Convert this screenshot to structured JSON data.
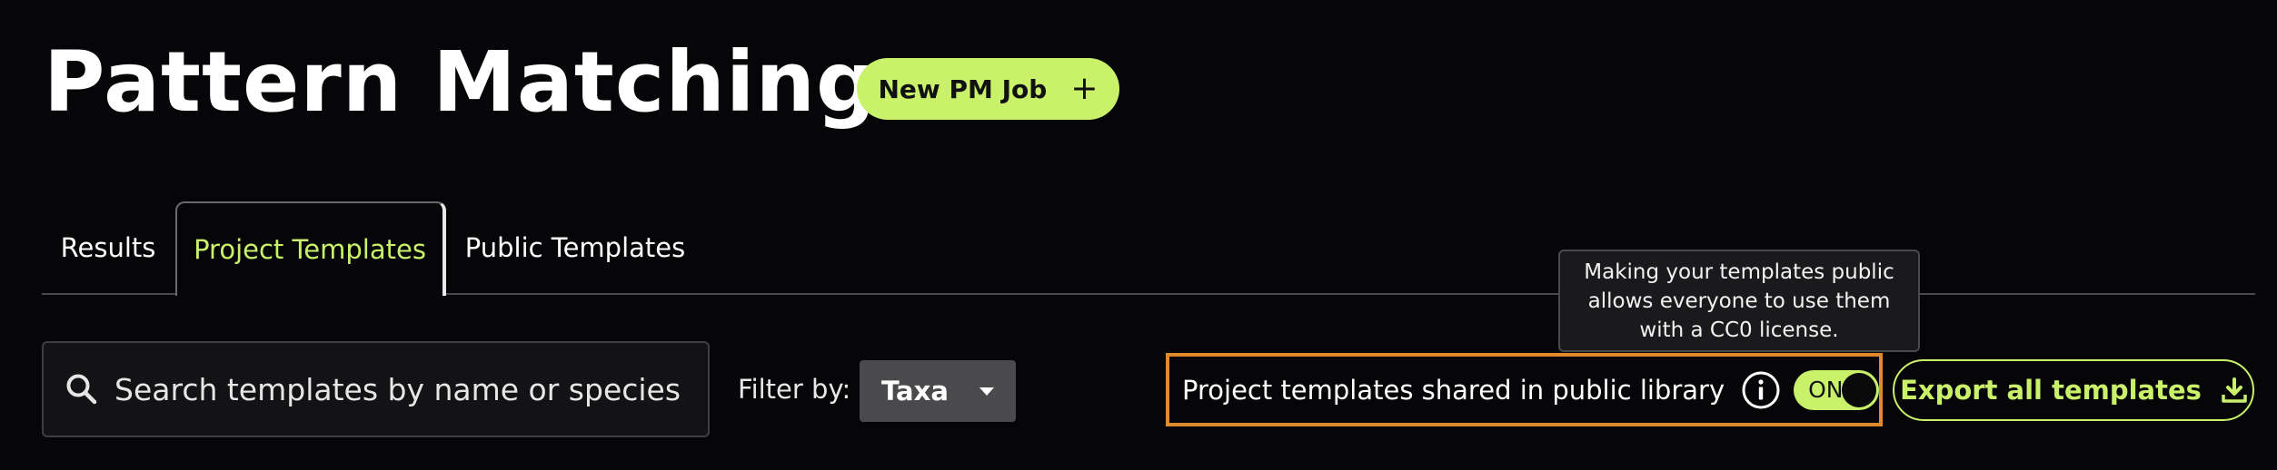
{
  "header": {
    "title": "Pattern Matching",
    "new_job_label": "New PM Job",
    "new_job_icon": "plus-icon"
  },
  "tabs": [
    {
      "label": "Results",
      "active": false
    },
    {
      "label": "Project Templates",
      "active": true
    },
    {
      "label": "Public Templates",
      "active": false
    }
  ],
  "search": {
    "placeholder": "Search templates by name or species",
    "value": "",
    "icon": "search-icon"
  },
  "filter": {
    "label": "Filter by:",
    "selected": "Taxa"
  },
  "tooltip": {
    "lines": [
      "Making your templates public",
      "allows everyone to use them",
      "with a CC0 license."
    ]
  },
  "share": {
    "label": "Project templates shared in public library",
    "info_icon": "info-icon",
    "toggle_label": "ON",
    "toggle_on": true
  },
  "export": {
    "label": "Export all templates",
    "icon": "download-icon"
  },
  "colors": {
    "background": "#060608",
    "accent": "#c9f26a",
    "highlight_border": "#e08a2e",
    "tab_line": "#4a4a4e"
  }
}
